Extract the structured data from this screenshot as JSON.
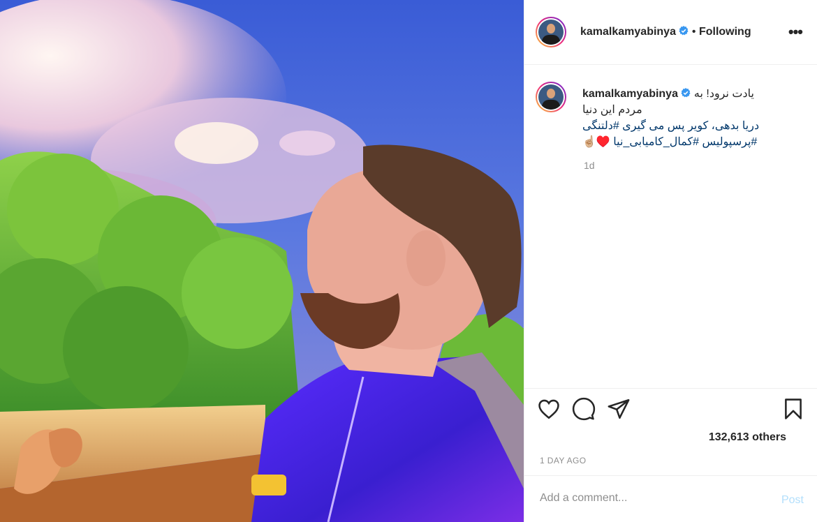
{
  "post": {
    "username": "kamalkamyabinya",
    "following_label": "Following",
    "separator": "•",
    "more_label": "•••",
    "caption_lines": [
      "یادت نرود! به",
      "مردم این دنیا",
      "دریا بدهی، کویر پس می گیری #دلتنگی",
      "#پرسپولیس #کمال_کامیابی_نیا ♥️☝🏼"
    ],
    "caption_time": "1d",
    "likes_text": "132,613 others",
    "time_ago": "1 DAY AGO",
    "comment_placeholder": "Add a comment...",
    "post_button": "Post"
  },
  "icons": {
    "verified": "verified-badge-icon",
    "like": "heart-icon",
    "comment": "comment-bubble-icon",
    "share": "paper-plane-icon",
    "save": "bookmark-icon"
  },
  "colors": {
    "verified": "#3897f0",
    "link": "#00376b",
    "muted": "#8e8e8e",
    "post_button": "#b2dffc"
  }
}
